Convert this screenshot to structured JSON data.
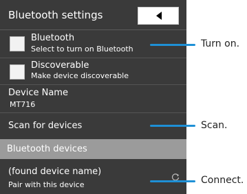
{
  "header": {
    "title": "Bluetooth settings"
  },
  "settings": {
    "bluetooth": {
      "title": "Bluetooth",
      "subtitle": "Select to turn on Bluetooth",
      "checked": false
    },
    "discoverable": {
      "title": "Discoverable",
      "subtitle": "Make device discoverable",
      "checked": false
    },
    "device_name": {
      "title": "Device Name",
      "value": "MT716"
    },
    "scan": {
      "label": "Scan for devices"
    }
  },
  "devices_section": {
    "header": "Bluetooth devices",
    "device": {
      "name": "(found device name)",
      "action": "Pair with this device"
    }
  },
  "callouts": {
    "turn_on": "Turn on.",
    "scan": "Scan.",
    "connect": "Connect."
  },
  "colors": {
    "panel": "#3a3a3a",
    "section_band": "#9b9b9b",
    "callout_line": "#1e90d6"
  },
  "icons": {
    "back": "back-triangle-icon",
    "refresh": "refresh-icon"
  }
}
